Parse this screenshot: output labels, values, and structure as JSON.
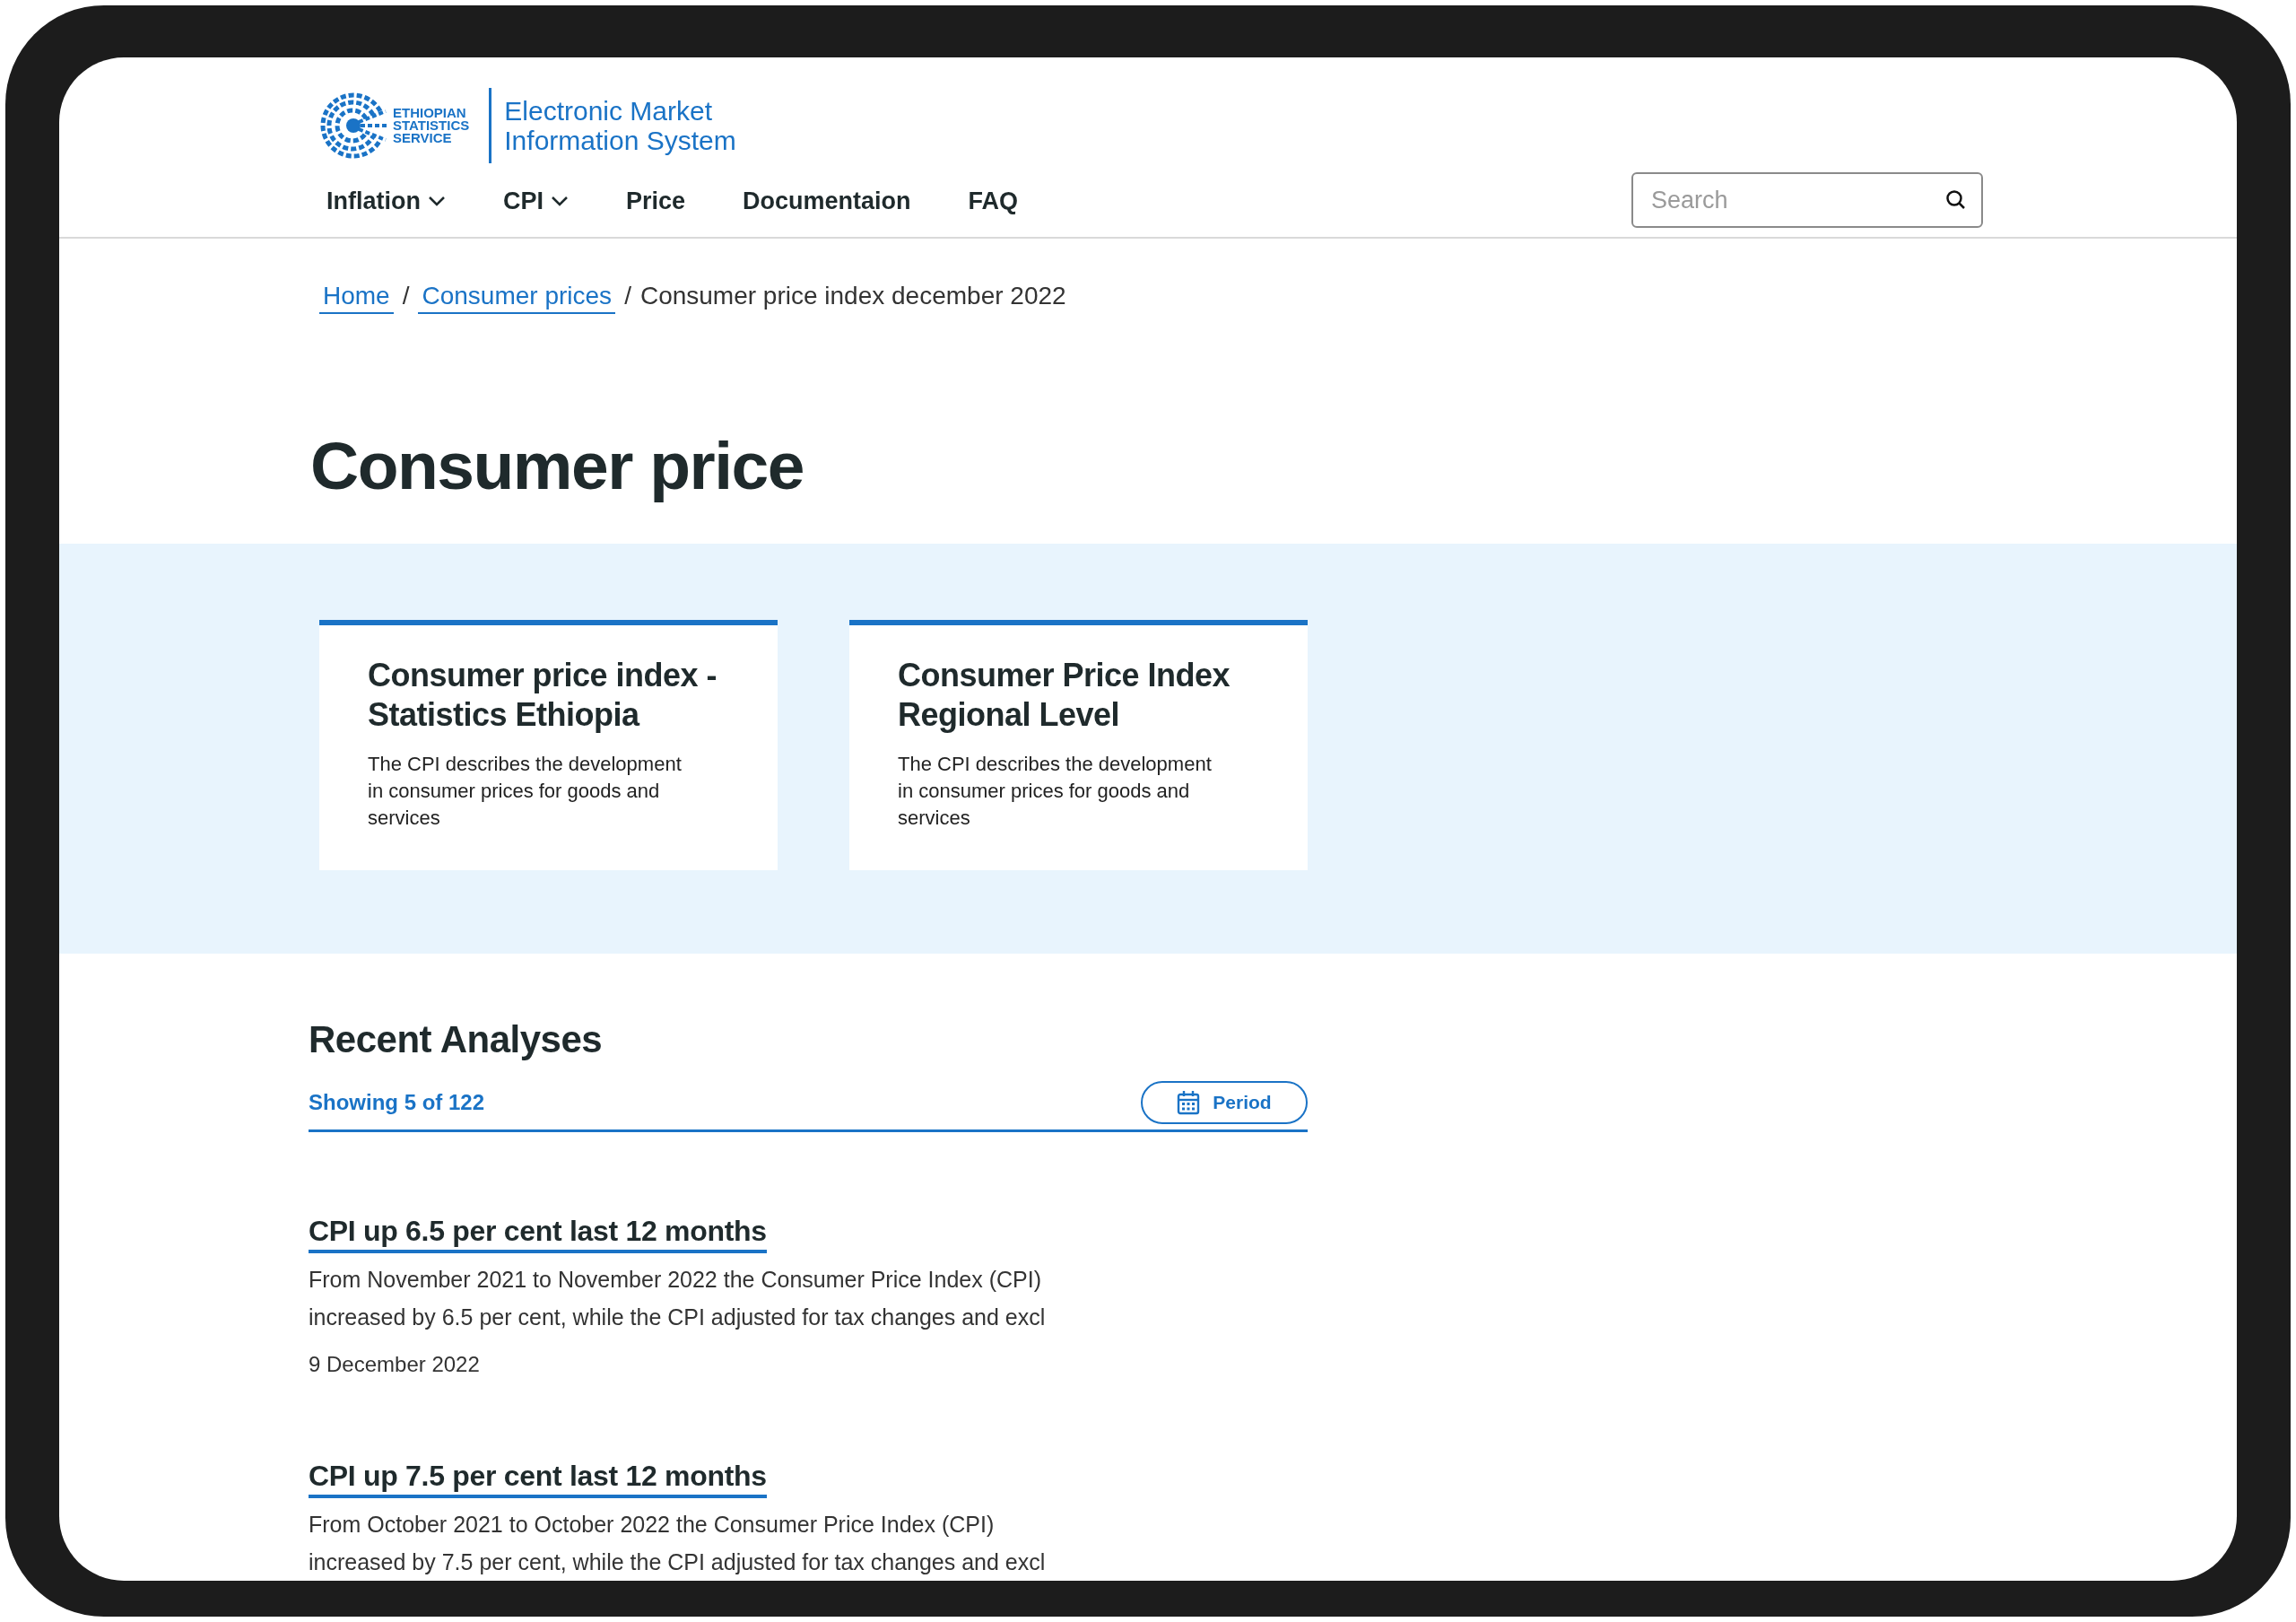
{
  "header": {
    "logo_text": [
      "ETHIOPIAN",
      "STATISTICS",
      "SERVICE"
    ],
    "site_title": [
      "Electronic Market",
      "Information System"
    ],
    "nav": [
      {
        "label": "Inflation",
        "has_menu": true
      },
      {
        "label": "CPI",
        "has_menu": true
      },
      {
        "label": "Price",
        "has_menu": false
      },
      {
        "label": "Documentaion",
        "has_menu": false
      },
      {
        "label": "FAQ",
        "has_menu": false
      }
    ],
    "search": {
      "placeholder": "Search"
    }
  },
  "breadcrumb": [
    {
      "kind": "link",
      "label": "Home"
    },
    {
      "kind": "separator",
      "label": "/"
    },
    {
      "kind": "link",
      "label": "Consumer prices"
    },
    {
      "kind": "separator",
      "label": "/"
    },
    {
      "kind": "current",
      "label": "Consumer price index december 2022"
    }
  ],
  "page_title": "Consumer price",
  "cards": [
    {
      "title": "Consumer price index - Statistics Ethiopia",
      "description": "The CPI describes the development in consumer prices for goods and services"
    },
    {
      "title": "Consumer Price Index Regional Level",
      "description": "The CPI describes the development in consumer prices for goods and services"
    }
  ],
  "recent": {
    "heading": "Recent Analyses",
    "count": "Showing 5 of 122",
    "filter_button": "Period",
    "articles": [
      {
        "title": "CPI up 6.5 per cent last 12 months",
        "summary": [
          "From November 2021 to November 2022 the Consumer Price Index (CPI)",
          "increased by 6.5 per cent, while the CPI adjusted for tax changes and excl"
        ],
        "date": "9 December 2022"
      },
      {
        "title": "CPI up 7.5 per cent last 12 months",
        "summary": [
          "From October 2021 to October 2022 the Consumer Price Index (CPI)",
          "increased by 7.5 per cent, while the CPI adjusted for tax changes and excl"
        ]
      }
    ]
  }
}
